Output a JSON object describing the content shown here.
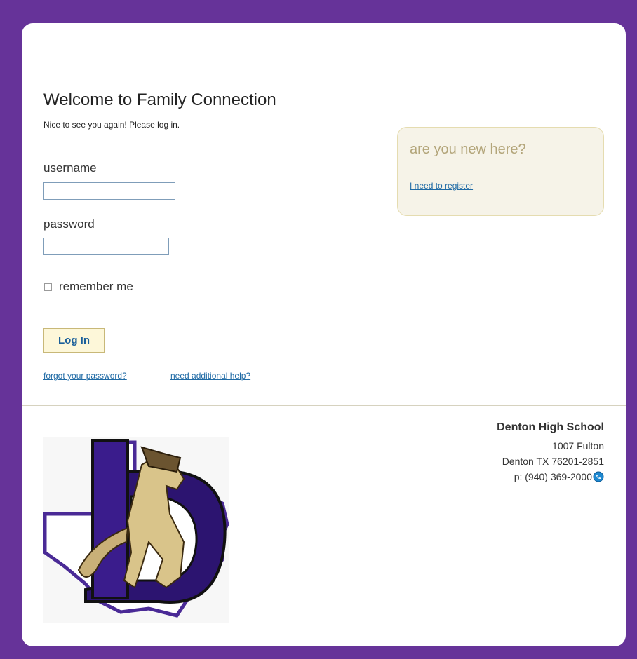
{
  "login": {
    "title": "Welcome to Family Connection",
    "subtitle": "Nice to see you again! Please log in.",
    "username_label": "username",
    "username_value": "",
    "password_label": "password",
    "password_value": "",
    "remember_label": "remember me",
    "login_button": "Log In",
    "forgot_link": "forgot your password?",
    "help_link": "need additional help?"
  },
  "new_user": {
    "title": "are you new here?",
    "register_link": "I need to register"
  },
  "school": {
    "name": "Denton High School",
    "address_line1": "1007 Fulton",
    "address_line2": "Denton TX 76201-2851",
    "phone": "p: (940) 369-2000"
  },
  "colors": {
    "background": "#663399",
    "link": "#1f6aa5",
    "accent_box": "#f6f3e8",
    "logo_purple": "#2c1470",
    "logo_gold": "#d9c48a"
  },
  "icons": {
    "phone": "phone-call-icon",
    "logo": "school-mustang-logo"
  }
}
